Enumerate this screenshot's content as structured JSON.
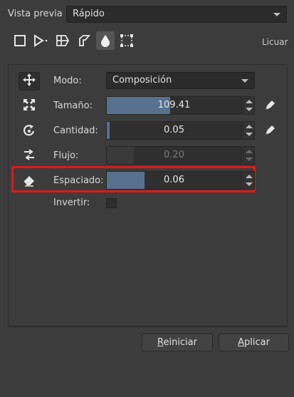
{
  "header": {
    "preview_label": "Vista previa",
    "preview_mode": "Rápido",
    "licuar_label": "Licuar"
  },
  "mode_icons": [
    "square-transform-icon",
    "cage-transform-icon",
    "warp-transform-icon",
    "perspective-transform-icon",
    "liquify-drop-icon",
    "mesh-transform-icon"
  ],
  "options": {
    "mode_label": "Modo:",
    "mode_value": "Composición",
    "size_label": "Tamaño:",
    "size_value": "109.41",
    "size_fraction": 0.47,
    "amount_label": "Cantidad:",
    "amount_value": "0.05",
    "amount_fraction": 0.01,
    "flow_label": "Flujo:",
    "flow_value": "0.20",
    "flow_fraction": 0.2,
    "spacing_label": "Espaciado:",
    "spacing_value": "0.06",
    "spacing_fraction": 0.28,
    "invert_label": "Invertir:"
  },
  "footer": {
    "reset_first": "R",
    "reset_rest": "einiciar",
    "apply_first": "A",
    "apply_rest": "plicar"
  },
  "colors": {
    "highlight": "#e01818",
    "slider_fill": "#57718f"
  }
}
